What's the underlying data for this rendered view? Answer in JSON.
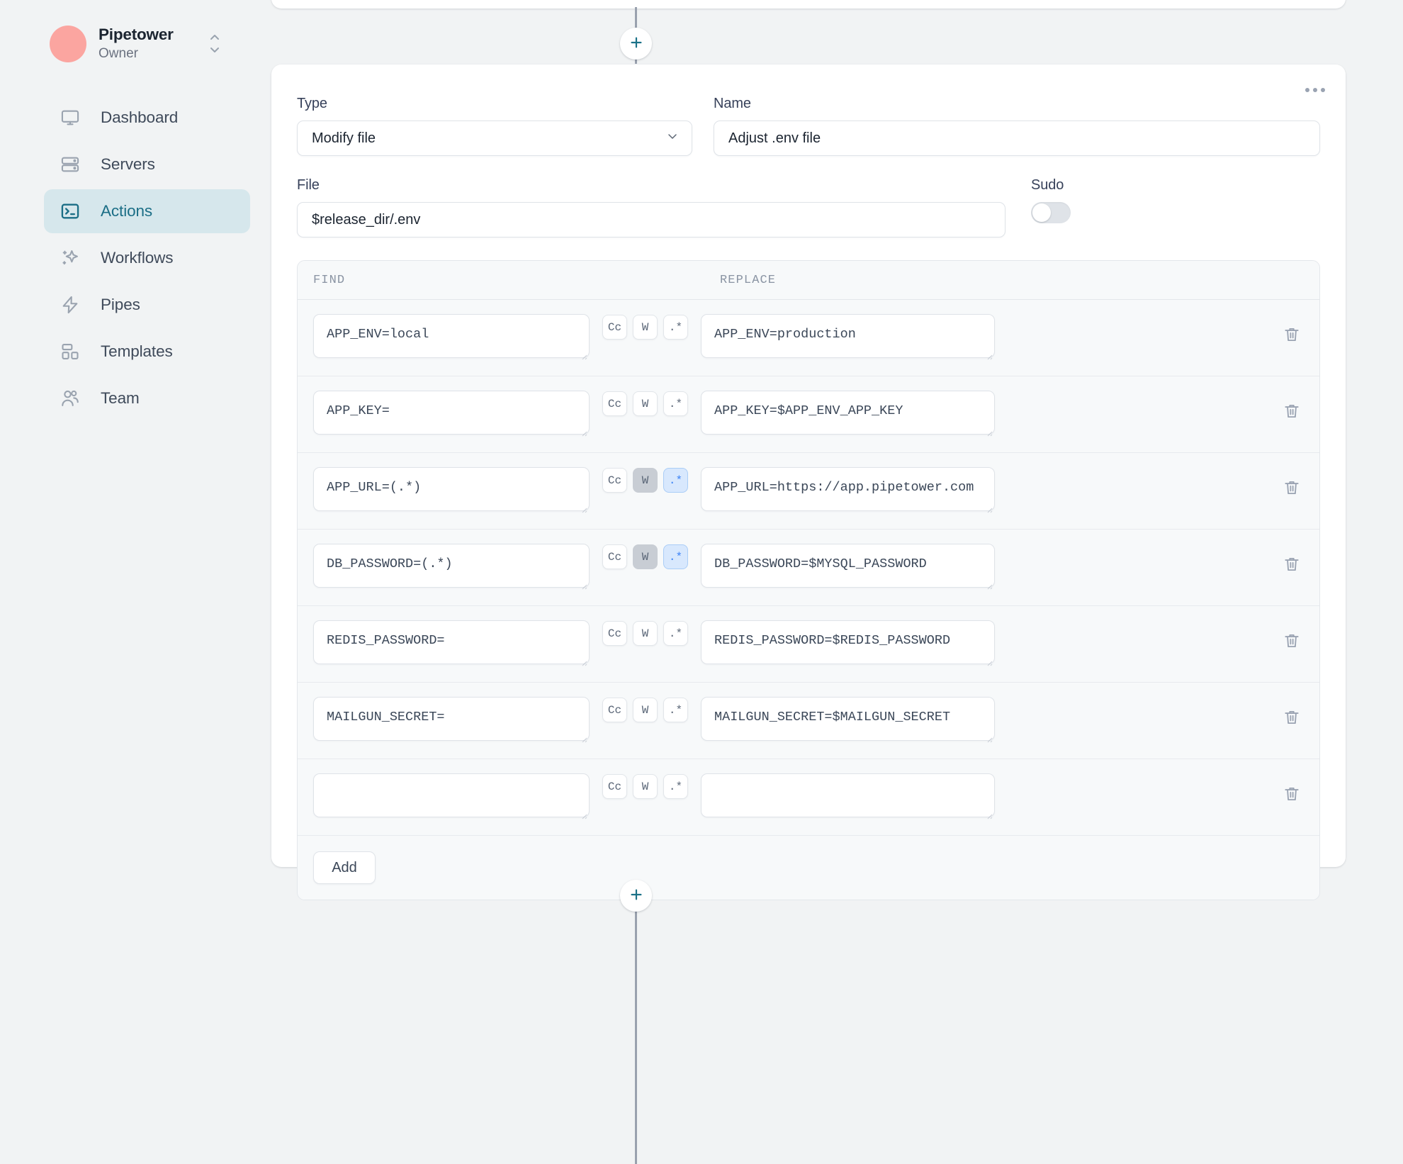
{
  "sidebar": {
    "workspace": {
      "name": "Pipetower",
      "role": "Owner",
      "avatar_color": "#fba5a0",
      "switcher_icon": "chevron-updown-icon"
    },
    "items": [
      {
        "label": "Dashboard",
        "icon": "monitor-icon",
        "active": false
      },
      {
        "label": "Servers",
        "icon": "server-icon",
        "active": false
      },
      {
        "label": "Actions",
        "icon": "terminal-icon",
        "active": true
      },
      {
        "label": "Workflows",
        "icon": "sparkles-icon",
        "active": false
      },
      {
        "label": "Pipes",
        "icon": "lightning-icon",
        "active": false
      },
      {
        "label": "Templates",
        "icon": "layout-icon",
        "active": false
      },
      {
        "label": "Team",
        "icon": "users-icon",
        "active": false
      }
    ],
    "active_bg": "#d6e7ec",
    "active_fg": "#1b6e86"
  },
  "canvas": {
    "add_step_label": "+",
    "accent_color": "#1b7288",
    "connector_color": "#99a1ae"
  },
  "card": {
    "menu_icon": "ellipsis-icon",
    "type": {
      "label": "Type",
      "value": "Modify file",
      "chevron": "chevron-down-icon"
    },
    "name": {
      "label": "Name",
      "value": "Adjust .env file",
      "placeholder": "Name"
    },
    "file": {
      "label": "File",
      "value": "$release_dir/.env",
      "placeholder": "File"
    },
    "sudo": {
      "label": "Sudo",
      "enabled": false
    }
  },
  "find_replace": {
    "headers": {
      "find": "FIND",
      "replace": "REPLACE"
    },
    "flag_labels": {
      "case": "Cc",
      "word": "W",
      "regex": ".*"
    },
    "delete_icon": "trash-icon",
    "add_label": "Add",
    "rows": [
      {
        "find": "APP_ENV=local",
        "replace": "APP_ENV=production",
        "case": false,
        "word": false,
        "regex": false
      },
      {
        "find": "APP_KEY=",
        "replace": "APP_KEY=$APP_ENV_APP_KEY",
        "case": false,
        "word": false,
        "regex": false
      },
      {
        "find": "APP_URL=(.*)",
        "replace": "APP_URL=https://app.pipetower.com",
        "case": false,
        "word": "off",
        "regex": true
      },
      {
        "find": "DB_PASSWORD=(.*)",
        "replace": "DB_PASSWORD=$MYSQL_PASSWORD",
        "case": false,
        "word": "off",
        "regex": true
      },
      {
        "find": "REDIS_PASSWORD=",
        "replace": "REDIS_PASSWORD=$REDIS_PASSWORD",
        "case": false,
        "word": false,
        "regex": false
      },
      {
        "find": "MAILGUN_SECRET=",
        "replace": "MAILGUN_SECRET=$MAILGUN_SECRET",
        "case": false,
        "word": false,
        "regex": false
      },
      {
        "find": "",
        "replace": "",
        "case": false,
        "word": false,
        "regex": false
      }
    ]
  }
}
